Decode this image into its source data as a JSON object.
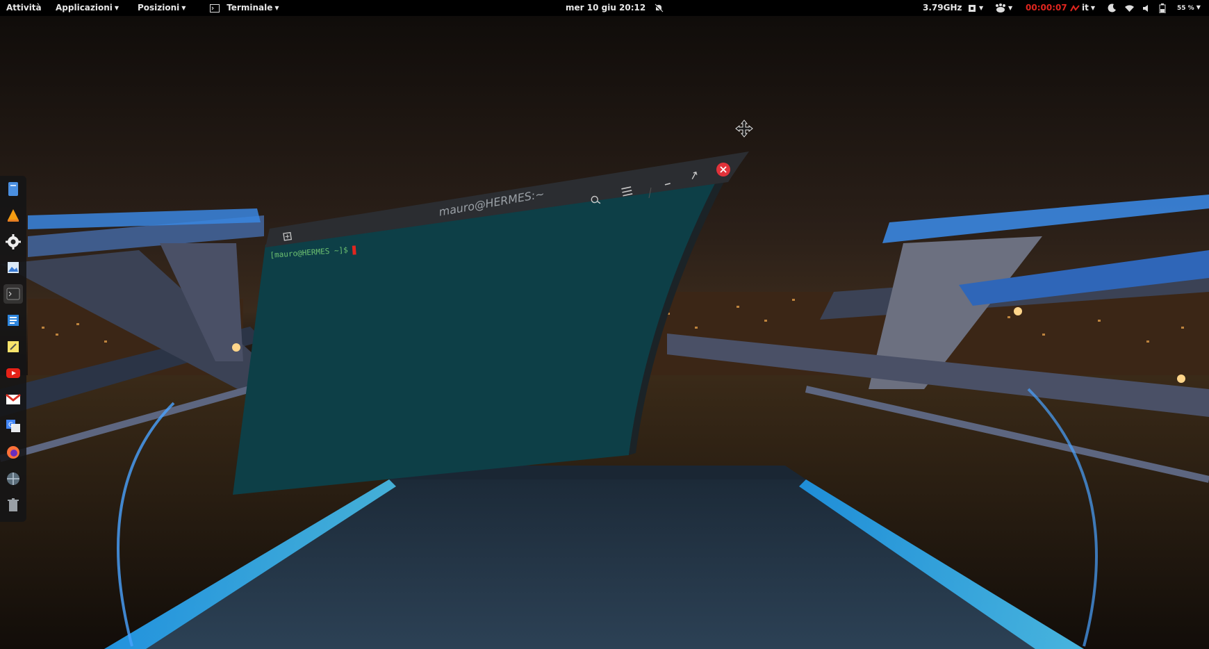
{
  "topbar": {
    "activities": "Attività",
    "applications": "Applicazioni",
    "places": "Posizioni",
    "app_menu": "Terminale",
    "clock": "mer 10 giu  20:12",
    "cpu_freq": "3.79GHz",
    "timer": "00:00:07",
    "keyboard_layout": "it",
    "battery": "55 %"
  },
  "dock": {
    "items": [
      "files-icon",
      "vlc-icon",
      "settings-icon",
      "image-viewer-icon",
      "terminal-icon",
      "text-editor-icon",
      "notes-icon",
      "youtube-icon",
      "gmail-icon",
      "translate-icon",
      "firefox-icon",
      "network-icon",
      "trash-icon"
    ],
    "active_index": 4
  },
  "terminal": {
    "title": "mauro@HERMES:~",
    "prompt": "[mauro@HERMES ~]$",
    "background": "#0d3f47",
    "header_color": "#2b2d31"
  }
}
